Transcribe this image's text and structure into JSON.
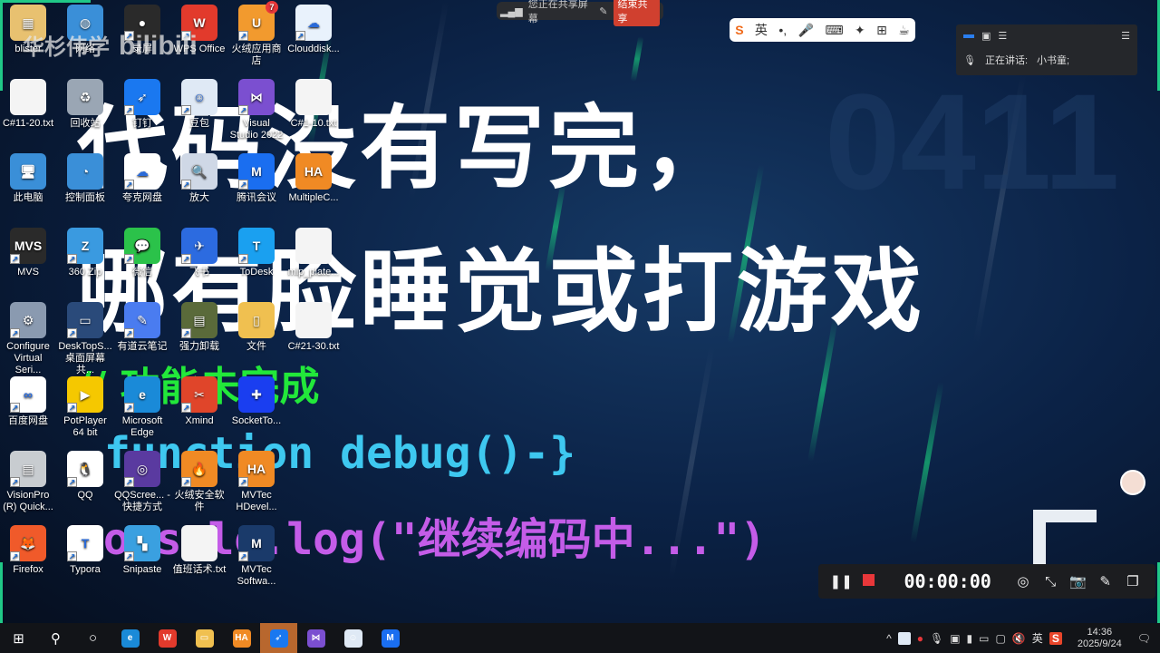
{
  "wallpaper": {
    "line1": "代码没有写完，",
    "line2": "哪有脸睡觉或打游戏",
    "line3": "// 功能未完成",
    "line4": "function debug()-}",
    "line5": "console.log(\"继续编码中...\")",
    "number": "0411"
  },
  "watermark": {
    "channel": "华杉伟学",
    "site": "bilibili"
  },
  "desktop_icons": [
    {
      "label": "blister",
      "glyph": "▦",
      "color": "#e8c170",
      "col": 0,
      "row": 0
    },
    {
      "label": "网络",
      "glyph": "◍",
      "color": "#3a8fd8",
      "col": 1,
      "row": 0
    },
    {
      "label": "录屏",
      "glyph": "●",
      "color": "#2a2a2a",
      "col": 2,
      "row": 0,
      "shortcut": true
    },
    {
      "label": "WPS Office",
      "glyph": "W",
      "color": "#e23a2c",
      "col": 3,
      "row": 0,
      "shortcut": true
    },
    {
      "label": "火绒应用商店",
      "glyph": "U",
      "color": "#f29a2e",
      "col": 4,
      "row": 0,
      "shortcut": true,
      "badge": "7"
    },
    {
      "label": "Clouddisk...",
      "glyph": "☁",
      "color": "#e9f2fc",
      "col": 5,
      "row": 0,
      "shortcut": true
    },
    {
      "label": "C#11-20.txt",
      "glyph": "",
      "color": "#f4f4f4",
      "col": 0,
      "row": 1
    },
    {
      "label": "回收站",
      "glyph": "♻",
      "color": "#9aa6b4",
      "col": 1,
      "row": 1
    },
    {
      "label": "钉钉",
      "glyph": "➶",
      "color": "#1a78f0",
      "col": 2,
      "row": 1,
      "shortcut": true
    },
    {
      "label": "豆包",
      "glyph": "☺",
      "color": "#dfe9f5",
      "col": 3,
      "row": 1,
      "shortcut": true
    },
    {
      "label": "Visual Studio 2022",
      "glyph": "⋈",
      "color": "#7b4fd0",
      "col": 4,
      "row": 1,
      "shortcut": true
    },
    {
      "label": "C#1-10.txt",
      "glyph": "",
      "color": "#f4f4f4",
      "col": 5,
      "row": 1
    },
    {
      "label": "此电脑",
      "glyph": "🖥",
      "color": "#3a8fd8",
      "col": 0,
      "row": 2
    },
    {
      "label": "控制面板",
      "glyph": "◔",
      "color": "#3a8fd8",
      "col": 1,
      "row": 2
    },
    {
      "label": "夸克网盘",
      "glyph": "☁",
      "color": "#ffffff",
      "col": 2,
      "row": 2,
      "shortcut": true
    },
    {
      "label": "放大",
      "glyph": "🔍",
      "color": "#cfd8e6",
      "col": 3,
      "row": 2,
      "shortcut": true
    },
    {
      "label": "腾讯会议",
      "glyph": "M",
      "color": "#1a6ef0",
      "col": 4,
      "row": 2,
      "shortcut": true
    },
    {
      "label": "MultipleC...",
      "glyph": "HA",
      "color": "#f08a24",
      "col": 5,
      "row": 2
    },
    {
      "label": "MVS",
      "glyph": "MVS",
      "color": "#2a2a2a",
      "col": 0,
      "row": 3,
      "shortcut": true
    },
    {
      "label": "360 Zip",
      "glyph": "Z",
      "color": "#3a9ae0",
      "col": 1,
      "row": 3,
      "shortcut": true
    },
    {
      "label": "微信",
      "glyph": "💬",
      "color": "#2bc24a",
      "col": 2,
      "row": 3,
      "shortcut": true
    },
    {
      "label": "飞书",
      "glyph": "✈",
      "color": "#2c6be0",
      "col": 3,
      "row": 3,
      "shortcut": true
    },
    {
      "label": "ToDesk",
      "glyph": "T",
      "color": "#1aa0f0",
      "col": 4,
      "row": 3,
      "shortcut": true
    },
    {
      "label": "mlp_plate...",
      "glyph": "",
      "color": "#f4f4f4",
      "col": 5,
      "row": 3
    },
    {
      "label": "Configure Virtual Seri...",
      "glyph": "⚙",
      "color": "#8a9ab0",
      "col": 0,
      "row": 4,
      "shortcut": true
    },
    {
      "label": "DeskTopS... 桌面屏幕共...",
      "glyph": "▭",
      "color": "#2a4a7a",
      "col": 1,
      "row": 4,
      "shortcut": true
    },
    {
      "label": "有道云笔记",
      "glyph": "✎",
      "color": "#4a7cf0",
      "col": 2,
      "row": 4,
      "shortcut": true
    },
    {
      "label": "强力卸载",
      "glyph": "▤",
      "color": "#5a6a3a",
      "col": 3,
      "row": 4,
      "shortcut": true
    },
    {
      "label": "文件",
      "glyph": "▯",
      "color": "#f0c050",
      "col": 4,
      "row": 4
    },
    {
      "label": "C#21-30.txt",
      "glyph": "",
      "color": "#f4f4f4",
      "col": 5,
      "row": 4
    },
    {
      "label": "百度网盘",
      "glyph": "∞",
      "color": "#ffffff",
      "col": 0,
      "row": 5,
      "shortcut": true
    },
    {
      "label": "PotPlayer 64 bit",
      "glyph": "▶",
      "color": "#f5c800",
      "col": 1,
      "row": 5,
      "shortcut": true
    },
    {
      "label": "Microsoft Edge",
      "glyph": "e",
      "color": "#1a8ad8",
      "col": 2,
      "row": 5,
      "shortcut": true
    },
    {
      "label": "Xmind",
      "glyph": "✂",
      "color": "#e0452a",
      "col": 3,
      "row": 5,
      "shortcut": true
    },
    {
      "label": "SocketTo...",
      "glyph": "✚",
      "color": "#1a3ef0",
      "col": 4,
      "row": 5
    },
    {
      "label": "VisionPro (R) Quick...",
      "glyph": "▤",
      "color": "#c8ccd0",
      "col": 0,
      "row": 6,
      "shortcut": true
    },
    {
      "label": "QQ",
      "glyph": "🐧",
      "color": "#ffffff",
      "col": 1,
      "row": 6,
      "shortcut": true
    },
    {
      "label": "QQScree... - 快捷方式",
      "glyph": "◎",
      "color": "#5a3aa0",
      "col": 2,
      "row": 6,
      "shortcut": true
    },
    {
      "label": "火绒安全软件",
      "glyph": "🔥",
      "color": "#f08a24",
      "col": 3,
      "row": 6,
      "shortcut": true
    },
    {
      "label": "MVTec HDevel...",
      "glyph": "HA",
      "color": "#f08a24",
      "col": 4,
      "row": 6,
      "shortcut": true
    },
    {
      "label": "Firefox",
      "glyph": "🦊",
      "color": "#f05a2a",
      "col": 0,
      "row": 7,
      "shortcut": true
    },
    {
      "label": "Typora",
      "glyph": "T",
      "color": "#ffffff",
      "col": 1,
      "row": 7,
      "shortcut": true
    },
    {
      "label": "Snipaste",
      "glyph": "▚",
      "color": "#3aa0e0",
      "col": 2,
      "row": 7,
      "shortcut": true
    },
    {
      "label": "值班话术.txt",
      "glyph": "",
      "color": "#f4f4f4",
      "col": 3,
      "row": 7
    },
    {
      "label": "MVTec Softwa...",
      "glyph": "M",
      "color": "#1a3a6a",
      "col": 4,
      "row": 7,
      "shortcut": true
    }
  ],
  "share_bar": {
    "status": "您正在共享屏幕",
    "end_button": "结束共享"
  },
  "ime_toolbar": {
    "logo": "S",
    "lang": "英",
    "punct": "•,",
    "items": [
      "🎤",
      "⌨",
      "✦",
      "⊞",
      "☕"
    ]
  },
  "meeting_panel": {
    "speaking_label": "正在讲话:",
    "speaker": "小书童;"
  },
  "recorder": {
    "time": "00:00:00"
  },
  "taskbar": {
    "apps": [
      {
        "name": "edge",
        "glyph": "e",
        "color": "#1a8ad8"
      },
      {
        "name": "wps",
        "glyph": "W",
        "color": "#e23a2c"
      },
      {
        "name": "file-explorer",
        "glyph": "▭",
        "color": "#f0c050"
      },
      {
        "name": "halcon",
        "glyph": "HA",
        "color": "#f08a24"
      },
      {
        "name": "dingtalk",
        "glyph": "➶",
        "color": "#1a78f0",
        "active": true
      },
      {
        "name": "visual-studio",
        "glyph": "⋈",
        "color": "#7b4fd0"
      },
      {
        "name": "doubao",
        "glyph": "☺",
        "color": "#dfe9f5"
      },
      {
        "name": "tencent-meeting",
        "glyph": "M",
        "color": "#1a6ef0"
      }
    ],
    "tray_lang": "英",
    "time": "14:36",
    "date": "2025/9/24"
  }
}
